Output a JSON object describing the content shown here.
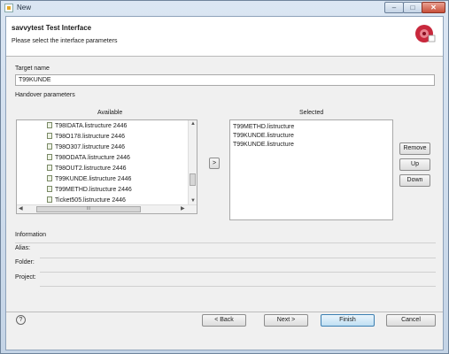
{
  "window": {
    "title": "New"
  },
  "banner": {
    "title": "savvytest Test Interface",
    "subtitle": "Please select the interface parameters"
  },
  "target": {
    "label": "Target name",
    "value": "T99KUNDE"
  },
  "handover": {
    "label": "Handover parameters",
    "available_label": "Available",
    "selected_label": "Selected",
    "available_items": [
      "T98IDATA.listructure 2446",
      "T98O178.listructure 2446",
      "T98O307.listructure 2446",
      "T98ODATA.listructure 2446",
      "T98OUT2.listructure 2446",
      "T99KUNDE.listructure 2446",
      "T99METHD.listructure 2446",
      "Ticket505.listructure 2446"
    ],
    "selected_items": [
      "T99METHD.listructure",
      "T99KUNDE.listructure",
      "T99KUNDE.listructure"
    ],
    "add_label": ">",
    "hscroll_grip": "III",
    "remove_label": "Remove",
    "up_label": "Up",
    "down_label": "Down"
  },
  "information": {
    "label": "Information",
    "alias_label": "Alias:",
    "folder_label": "Folder:",
    "project_label": "Project:"
  },
  "footer": {
    "help_label": "?",
    "back_label": "< Back",
    "next_label": "Next >",
    "finish_label": "Finish",
    "cancel_label": "Cancel"
  },
  "window_controls": {
    "minimize": "–",
    "maximize": "□",
    "close": "✕"
  },
  "colors": {
    "accent": "#3c7fb1",
    "title_bar": "#c4d4e6"
  },
  "icons": [
    "window-icon",
    "logo-icon",
    "file-icon",
    "help-icon"
  ]
}
